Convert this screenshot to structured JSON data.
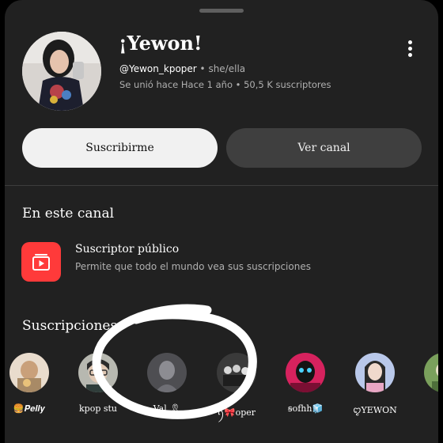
{
  "channel": {
    "name": "¡Yewon!",
    "handle": "@Yewon_kpoper",
    "pronouns": " • she/ella",
    "joined": "Se unió hace Hace 1 año • 50,5 K suscriptores"
  },
  "actions": {
    "subscribe_label": "Suscribirme",
    "view_channel_label": "Ver canal"
  },
  "on_channel": {
    "title": "En este canal",
    "feature": {
      "title": "Suscriptor público",
      "description": "Permite que todo el mundo vea sus suscripciones",
      "icon": "subscriptions-icon"
    }
  },
  "subscriptions": {
    "title": "Suscripciones",
    "items": [
      {
        "name": "🍔𝑷𝒆𝒍𝒍𝒚",
        "avatar_color": "#c9a07a"
      },
      {
        "name": "kpop stu",
        "avatar_color": "#8d8f86"
      },
      {
        "name": "Val 🎗",
        "avatar_color": "#6a6a6e"
      },
      {
        "name": "ꪆ🎀oper",
        "avatar_color": "#505050"
      },
      {
        "name": "ꞩofhh🧊",
        "avatar_color": "#d6225e"
      },
      {
        "name": "ꨄ︎YEWON",
        "avatar_color": "#b9c8ea"
      },
      {
        "name": "ꨄ︎",
        "avatar_color": "#7aa05c"
      }
    ]
  },
  "colors": {
    "sheet_bg": "#212121",
    "accent_red": "#ff3a3a"
  }
}
